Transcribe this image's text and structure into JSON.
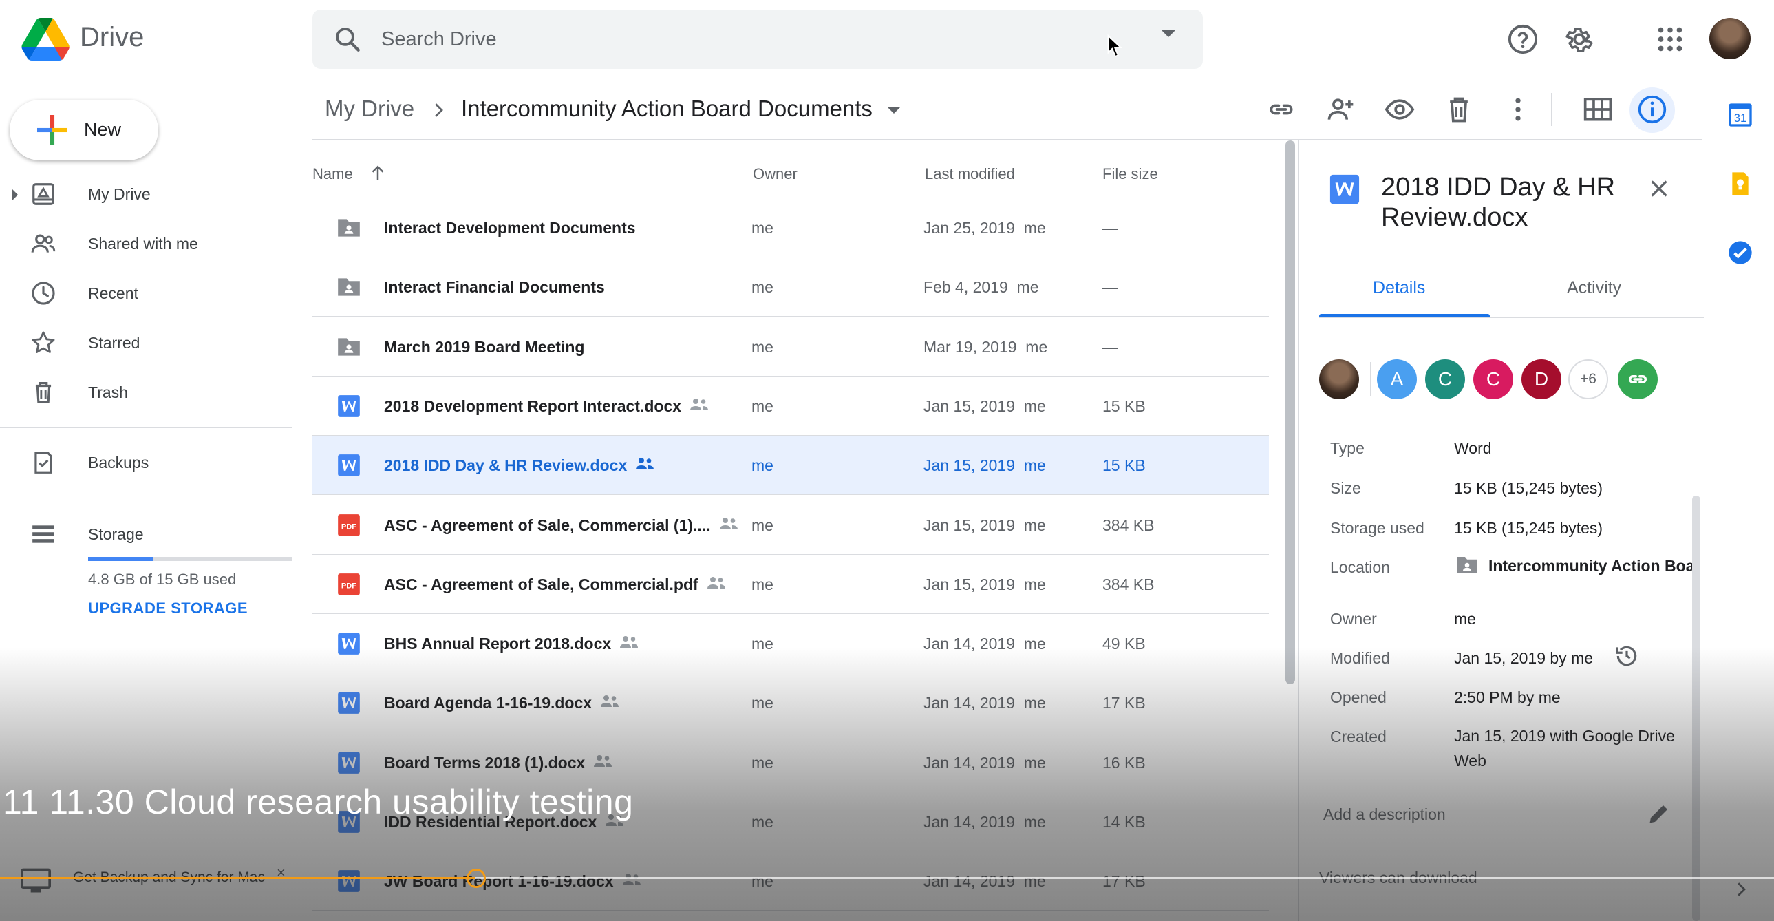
{
  "app": {
    "brand": "Drive",
    "search_placeholder": "Search Drive"
  },
  "sidebar": {
    "new_label": "New",
    "items": [
      {
        "label": "My Drive",
        "icon": "my-drive-icon"
      },
      {
        "label": "Shared with me",
        "icon": "people-icon"
      },
      {
        "label": "Recent",
        "icon": "clock-icon"
      },
      {
        "label": "Starred",
        "icon": "star-icon"
      },
      {
        "label": "Trash",
        "icon": "trash-icon"
      }
    ],
    "backups_label": "Backups",
    "storage_label": "Storage",
    "storage_used_fraction": 0.32,
    "storage_text": "4.8 GB of 15 GB used",
    "upgrade_label": "UPGRADE STORAGE",
    "promo_text": "Get Backup and Sync for Mac",
    "promo_close": "×"
  },
  "breadcrumb": {
    "root": "My Drive",
    "current": "Intercommunity Action Board Documents"
  },
  "list": {
    "headers": {
      "name": "Name",
      "owner": "Owner",
      "modified": "Last modified",
      "size": "File size"
    },
    "rows": [
      {
        "name": "Interact Development Documents",
        "type": "folder",
        "shared": false,
        "owner": "me",
        "modified": "Jan 25, 2019  me",
        "size": "—"
      },
      {
        "name": "Interact Financial Documents",
        "type": "folder",
        "shared": false,
        "owner": "me",
        "modified": "Feb 4, 2019  me",
        "size": "—"
      },
      {
        "name": "March 2019 Board Meeting",
        "type": "folder",
        "shared": false,
        "owner": "me",
        "modified": "Mar 19, 2019  me",
        "size": "—"
      },
      {
        "name": "2018 Development Report Interact.docx",
        "type": "word",
        "shared": true,
        "owner": "me",
        "modified": "Jan 15, 2019  me",
        "size": "15 KB"
      },
      {
        "name": "2018 IDD Day & HR Review.docx",
        "type": "word",
        "shared": true,
        "selected": true,
        "owner": "me",
        "modified": "Jan 15, 2019  me",
        "size": "15 KB"
      },
      {
        "name": "ASC - Agreement of Sale, Commercial (1)....",
        "type": "pdf",
        "shared": true,
        "owner": "me",
        "modified": "Jan 15, 2019  me",
        "size": "384 KB"
      },
      {
        "name": "ASC - Agreement of Sale, Commercial.pdf",
        "type": "pdf",
        "shared": true,
        "owner": "me",
        "modified": "Jan 15, 2019  me",
        "size": "384 KB"
      },
      {
        "name": "BHS Annual Report 2018.docx",
        "type": "word",
        "shared": true,
        "owner": "me",
        "modified": "Jan 14, 2019  me",
        "size": "49 KB"
      },
      {
        "name": "Board Agenda 1-16-19.docx",
        "type": "word",
        "shared": true,
        "owner": "me",
        "modified": "Jan 14, 2019  me",
        "size": "17 KB"
      },
      {
        "name": "Board Terms 2018 (1).docx",
        "type": "word",
        "shared": true,
        "owner": "me",
        "modified": "Jan 14, 2019  me",
        "size": "16 KB"
      },
      {
        "name": "IDD Residential Report.docx",
        "type": "word",
        "shared": true,
        "owner": "me",
        "modified": "Jan 14, 2019  me",
        "size": "14 KB"
      },
      {
        "name": "JW Board Report 1-16-19.docx",
        "type": "word",
        "shared": true,
        "owner": "me",
        "modified": "Jan 14, 2019  me",
        "size": "17 KB"
      }
    ]
  },
  "details": {
    "title": "2018 IDD Day & HR Review.docx",
    "tabs": [
      "Details",
      "Activity"
    ],
    "access": [
      {
        "letter": "A",
        "color": "#4a9ff0"
      },
      {
        "letter": "C",
        "color": "#1e8e7e"
      },
      {
        "letter": "C",
        "color": "#d81b60"
      },
      {
        "letter": "D",
        "color": "#a50e2d"
      }
    ],
    "more_people": "+6",
    "props": [
      {
        "key": "Type",
        "value": "Word"
      },
      {
        "key": "Size",
        "value": "15 KB (15,245 bytes)"
      },
      {
        "key": "Storage used",
        "value": "15 KB (15,245 bytes)"
      },
      {
        "key": "Location",
        "value": "Intercommunity Action Boa"
      },
      {
        "key": "Owner",
        "value": "me"
      },
      {
        "key": "Modified",
        "value": "Jan 15, 2019 by me"
      },
      {
        "key": "Opened",
        "value": "2:50 PM by me"
      },
      {
        "key": "Created",
        "value": "Jan 15, 2019 with Google Drive Web"
      }
    ],
    "description_placeholder": "Add a description",
    "viewers_text": "Viewers can download"
  },
  "rail": {
    "calendar_label": "31"
  },
  "video": {
    "caption": "11 11.30 Cloud research usability testing",
    "progress_fraction": 0.268
  },
  "colors": {
    "accent": "#1a73e8",
    "selected_row": "#e8f0fe",
    "word": "#4285f4",
    "pdf": "#ea4335",
    "progress": "#f29b17"
  }
}
